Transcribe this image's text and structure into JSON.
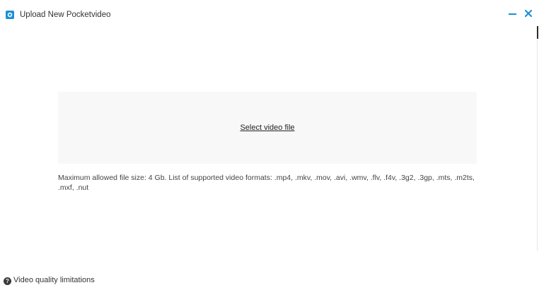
{
  "window": {
    "title": "Upload New Pocketvideo",
    "icons": {
      "app": "pocketvideo-logo-icon",
      "minimize": "minimize-icon",
      "close": "close-icon"
    },
    "accent_color": "#1e8fd6"
  },
  "upload": {
    "select_label": "Select video file",
    "help_text": "Maximum allowed file size: 4 Gb. List of supported video formats: .mp4, .mkv, .mov, .avi, .wmv, .flv, .f4v, .3g2, .3gp, .mts, .m2ts, .mxf, .nut"
  },
  "footer": {
    "quality_link_label": "Video quality limitations",
    "icon": "question-circle-icon"
  }
}
